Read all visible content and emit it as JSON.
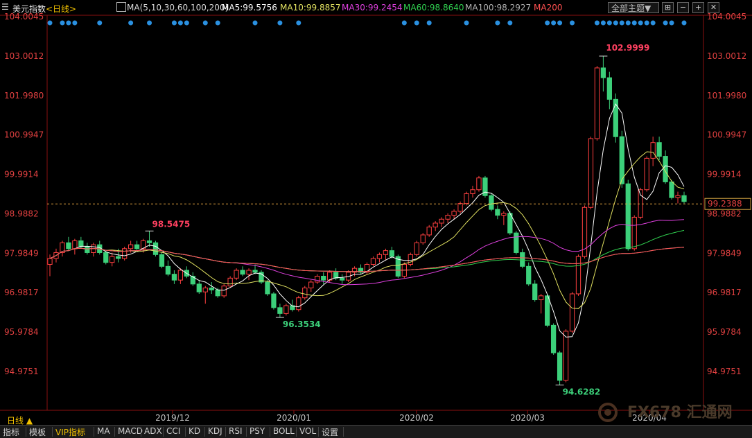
{
  "header": {
    "symbol": "美元指数",
    "period": "<日线>",
    "ma_params": "MA(5,10,30,60,100,200)",
    "ma5": "MA5:99.5756",
    "ma10": "MA10:99.8857",
    "ma30": "MA30:99.2454",
    "ma60": "MA60:98.8640",
    "ma100": "MA100:98.2927",
    "ma200": "MA200",
    "dropdown": "全部主题▼"
  },
  "colors": {
    "up": "#ff4040",
    "down": "#3cd07a",
    "ma5": "#ffffff",
    "ma10": "#e0e060",
    "ma30": "#e040e0",
    "ma60": "#30d050",
    "ma100": "#b0b0b0",
    "ma200": "#ff5050",
    "accent": "#f0c000"
  },
  "price_labels": [
    "104.0045",
    "103.0012",
    "101.9980",
    "100.9947",
    "99.9914",
    "98.9882",
    "97.9849",
    "96.9817",
    "95.9784",
    "94.9751"
  ],
  "current_price": "99.2388",
  "annotations": [
    {
      "text": "102.9999",
      "color": "#ff4060"
    },
    {
      "text": "98.5475",
      "color": "#ff4060"
    },
    {
      "text": "96.3534",
      "color": "#3cd07a"
    },
    {
      "text": "94.6282",
      "color": "#3cd07a"
    }
  ],
  "time_labels": [
    "2019/12",
    "2020/01",
    "2020/02",
    "2020/03",
    "2020/04"
  ],
  "period_tab": "日线 ▲",
  "bottom_tabs": [
    "指标",
    "模板",
    "VIP指标",
    "MA",
    "MACD",
    "ADX",
    "CCI",
    "KD",
    "KDJ",
    "RSI",
    "PSY",
    "BOLL",
    "VOL",
    "设置"
  ],
  "watermark": "FX678 汇通网",
  "chart_data": {
    "type": "candlestick",
    "title": "美元指数 日线",
    "ylim": [
      94.5,
      104.2
    ],
    "candles": [
      [
        97.7,
        97.95,
        97.4,
        97.85
      ],
      [
        97.85,
        98.1,
        97.75,
        98.0
      ],
      [
        98.0,
        98.3,
        97.9,
        98.25
      ],
      [
        98.25,
        98.4,
        98.05,
        98.1
      ],
      [
        98.1,
        98.35,
        97.95,
        98.3
      ],
      [
        98.3,
        98.4,
        98.1,
        98.15
      ],
      [
        98.15,
        98.25,
        97.95,
        98.0
      ],
      [
        98.0,
        98.25,
        97.9,
        98.2
      ],
      [
        98.2,
        98.3,
        97.95,
        98.0
      ],
      [
        98.0,
        98.05,
        97.7,
        97.75
      ],
      [
        97.75,
        98.0,
        97.65,
        97.9
      ],
      [
        97.9,
        98.1,
        97.75,
        97.85
      ],
      [
        97.85,
        98.15,
        97.8,
        98.1
      ],
      [
        98.1,
        98.3,
        98.0,
        98.2
      ],
      [
        98.2,
        98.3,
        98.05,
        98.1
      ],
      [
        98.1,
        98.35,
        98.0,
        98.3
      ],
      [
        98.3,
        98.55,
        98.15,
        98.25
      ],
      [
        98.25,
        98.3,
        97.9,
        97.95
      ],
      [
        97.95,
        98.0,
        97.6,
        97.65
      ],
      [
        97.65,
        97.8,
        97.4,
        97.45
      ],
      [
        97.45,
        97.55,
        97.2,
        97.3
      ],
      [
        97.3,
        97.6,
        97.2,
        97.55
      ],
      [
        97.55,
        97.65,
        97.35,
        97.4
      ],
      [
        97.4,
        97.5,
        97.15,
        97.2
      ],
      [
        97.2,
        97.3,
        96.95,
        97.0
      ],
      [
        97.0,
        97.15,
        96.7,
        97.1
      ],
      [
        97.1,
        97.25,
        96.95,
        97.05
      ],
      [
        97.05,
        97.1,
        96.85,
        96.9
      ],
      [
        96.9,
        97.2,
        96.85,
        97.15
      ],
      [
        97.15,
        97.4,
        97.1,
        97.35
      ],
      [
        97.35,
        97.6,
        97.3,
        97.55
      ],
      [
        97.55,
        97.65,
        97.4,
        97.45
      ],
      [
        97.45,
        97.6,
        97.3,
        97.55
      ],
      [
        97.55,
        97.7,
        97.45,
        97.5
      ],
      [
        97.5,
        97.55,
        97.2,
        97.25
      ],
      [
        97.25,
        97.3,
        96.9,
        96.95
      ],
      [
        96.95,
        97.0,
        96.55,
        96.6
      ],
      [
        96.6,
        96.7,
        96.35,
        96.45
      ],
      [
        96.45,
        96.7,
        96.4,
        96.65
      ],
      [
        96.65,
        96.8,
        96.5,
        96.55
      ],
      [
        96.55,
        96.9,
        96.5,
        96.85
      ],
      [
        96.85,
        97.15,
        96.8,
        97.1
      ],
      [
        97.1,
        97.3,
        97.0,
        97.25
      ],
      [
        97.25,
        97.45,
        97.2,
        97.4
      ],
      [
        97.4,
        97.5,
        97.2,
        97.3
      ],
      [
        97.3,
        97.55,
        97.25,
        97.5
      ],
      [
        97.5,
        97.6,
        97.3,
        97.35
      ],
      [
        97.35,
        97.45,
        97.2,
        97.3
      ],
      [
        97.3,
        97.55,
        97.25,
        97.5
      ],
      [
        97.5,
        97.65,
        97.4,
        97.6
      ],
      [
        97.6,
        97.7,
        97.45,
        97.5
      ],
      [
        97.5,
        97.75,
        97.45,
        97.7
      ],
      [
        97.7,
        97.9,
        97.65,
        97.85
      ],
      [
        97.85,
        98.0,
        97.75,
        97.95
      ],
      [
        97.95,
        98.1,
        97.8,
        98.05
      ],
      [
        98.05,
        98.15,
        97.85,
        97.9
      ],
      [
        97.9,
        97.95,
        97.35,
        97.4
      ],
      [
        97.4,
        97.75,
        97.35,
        97.7
      ],
      [
        97.7,
        98.0,
        97.65,
        97.95
      ],
      [
        97.95,
        98.3,
        97.9,
        98.25
      ],
      [
        98.25,
        98.5,
        98.2,
        98.45
      ],
      [
        98.45,
        98.7,
        98.4,
        98.65
      ],
      [
        98.65,
        98.8,
        98.55,
        98.75
      ],
      [
        98.75,
        98.9,
        98.65,
        98.85
      ],
      [
        98.85,
        99.0,
        98.75,
        98.95
      ],
      [
        98.95,
        99.1,
        98.85,
        99.05
      ],
      [
        99.05,
        99.3,
        99.0,
        99.25
      ],
      [
        99.25,
        99.55,
        99.2,
        99.5
      ],
      [
        99.5,
        99.7,
        99.4,
        99.6
      ],
      [
        99.6,
        99.95,
        99.55,
        99.9
      ],
      [
        99.9,
        99.95,
        99.4,
        99.45
      ],
      [
        99.45,
        99.5,
        99.05,
        99.1
      ],
      [
        99.1,
        99.2,
        98.85,
        98.95
      ],
      [
        98.95,
        99.05,
        98.7,
        99.0
      ],
      [
        99.0,
        99.05,
        98.45,
        98.5
      ],
      [
        98.5,
        98.55,
        97.95,
        98.0
      ],
      [
        98.0,
        98.1,
        97.6,
        97.65
      ],
      [
        97.65,
        97.75,
        97.15,
        97.2
      ],
      [
        97.2,
        97.3,
        96.75,
        96.8
      ],
      [
        96.8,
        96.95,
        96.45,
        96.9
      ],
      [
        96.9,
        96.95,
        96.1,
        96.15
      ],
      [
        96.15,
        96.2,
        95.4,
        95.45
      ],
      [
        95.45,
        95.5,
        94.63,
        94.75
      ],
      [
        94.75,
        96.05,
        94.7,
        96.0
      ],
      [
        96.0,
        97.0,
        95.95,
        96.95
      ],
      [
        96.95,
        97.95,
        96.9,
        97.9
      ],
      [
        97.9,
        99.2,
        97.85,
        99.15
      ],
      [
        99.15,
        100.95,
        99.1,
        100.9
      ],
      [
        100.9,
        102.75,
        100.85,
        102.7
      ],
      [
        102.7,
        103.0,
        102.1,
        102.45
      ],
      [
        102.45,
        102.6,
        101.65,
        101.9
      ],
      [
        101.9,
        102.05,
        100.8,
        100.95
      ],
      [
        100.95,
        101.1,
        99.65,
        99.75
      ],
      [
        99.75,
        99.85,
        98.05,
        98.1
      ],
      [
        98.1,
        98.95,
        98.05,
        98.9
      ],
      [
        98.9,
        99.65,
        98.85,
        99.6
      ],
      [
        99.6,
        100.45,
        99.55,
        100.4
      ],
      [
        100.4,
        100.95,
        100.2,
        100.8
      ],
      [
        100.8,
        100.95,
        100.35,
        100.45
      ],
      [
        100.45,
        100.6,
        99.75,
        99.8
      ],
      [
        99.8,
        99.85,
        99.35,
        99.4
      ],
      [
        99.4,
        99.55,
        99.25,
        99.45
      ],
      [
        99.45,
        99.55,
        99.25,
        99.3
      ]
    ],
    "moving_averages": {
      "ma5": 99.5756,
      "ma10": 99.8857,
      "ma30": 99.2454,
      "ma60": 98.864,
      "ma100": 98.2927
    },
    "high_marker": 102.9999,
    "low_marker": 94.6282,
    "current": 99.2388
  }
}
